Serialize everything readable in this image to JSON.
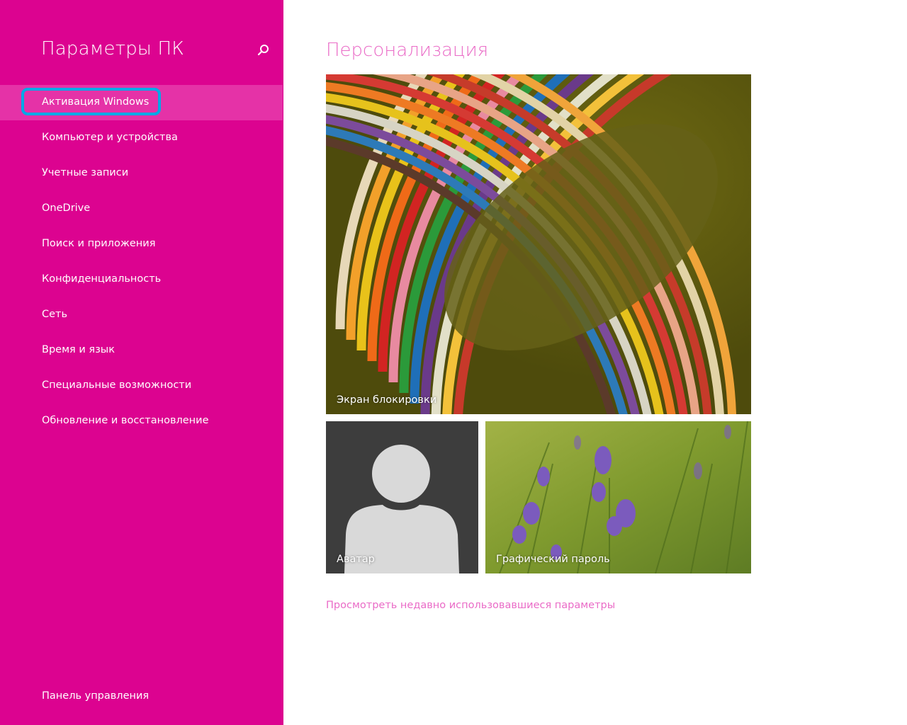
{
  "sidebar": {
    "title": "Параметры ПК",
    "search_icon": "search-icon",
    "items": [
      {
        "label": "Активация Windows",
        "selected": true
      },
      {
        "label": "Компьютер и устройства"
      },
      {
        "label": "Учетные записи"
      },
      {
        "label": "OneDrive"
      },
      {
        "label": "Поиск и приложения"
      },
      {
        "label": "Конфиденциальность"
      },
      {
        "label": "Сеть"
      },
      {
        "label": "Время и язык"
      },
      {
        "label": "Специальные возможности"
      },
      {
        "label": "Обновление и восстановление"
      }
    ],
    "footer_link": "Панель управления"
  },
  "main": {
    "title": "Персонализация",
    "tiles": {
      "lock_screen": "Экран блокировки",
      "avatar": "Аватар",
      "picture_password": "Графический пароль"
    },
    "recent_link": "Просмотреть недавно использовавшиеся параметры"
  },
  "colors": {
    "accent": "#dc0390",
    "accent_selected": "#e532a7",
    "title_pink": "#ea6bc7",
    "highlight_ring": "#00a9e6"
  }
}
